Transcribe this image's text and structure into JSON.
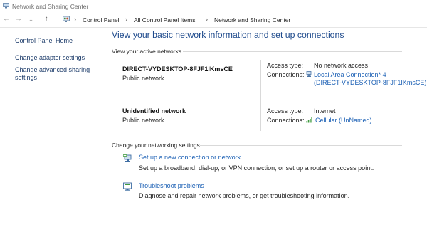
{
  "window": {
    "title": "Network and Sharing Center"
  },
  "nav": {
    "back": "←",
    "forward": "→",
    "history": "⌄",
    "up": "↑"
  },
  "address": {
    "crumbs": [
      "Control Panel",
      "All Control Panel Items",
      "Network and Sharing Center"
    ],
    "separator": "›"
  },
  "sidebar": {
    "home": "Control Panel Home",
    "adapter": "Change adapter settings",
    "advanced_line1": "Change advanced sharing",
    "advanced_line2": "settings"
  },
  "main": {
    "heading": "View your basic network information and set up connections",
    "active_label": "View your active networks",
    "change_label": "Change your networking settings"
  },
  "networks": [
    {
      "name": "DIRECT-VYDESKTOP-8FJF1IKmsCE",
      "type": "Public network",
      "access_label": "Access type:",
      "access_value": "No network access",
      "conn_label": "Connections:",
      "conn_value": "Local Area Connection* 4",
      "conn_value2": "(DIRECT-VYDESKTOP-8FJF1IKmsCE)"
    },
    {
      "name": "Unidentified network",
      "type": "Public network",
      "access_label": "Access type:",
      "access_value": "Internet",
      "conn_label": "Connections:",
      "conn_value": "Cellular (UnNamed)"
    }
  ],
  "tasks": [
    {
      "icon": "new-connection-icon",
      "link": "Set up a new connection or network",
      "desc": "Set up a broadband, dial-up, or VPN connection; or set up a router or access point."
    },
    {
      "icon": "troubleshoot-icon",
      "link": "Troubleshoot problems",
      "desc": "Diagnose and repair network problems, or get troubleshooting information."
    }
  ],
  "colors": {
    "heading": "#1e4a8c",
    "link": "#1a5fb4",
    "sidebar_link": "#1e3d6b"
  }
}
